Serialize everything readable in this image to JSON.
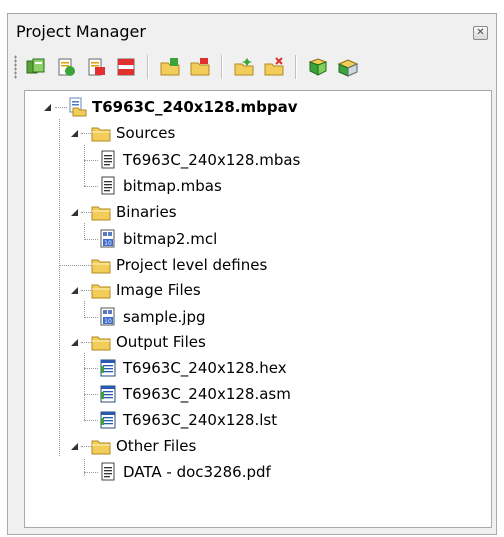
{
  "panel": {
    "title": "Project Manager"
  },
  "toolbar": {
    "buttons": [
      "open-project-icon",
      "add-file-icon",
      "remove-file-icon",
      "remove-all-icon",
      "new-folder-icon",
      "rename-folder-icon",
      "add-folder-icon",
      "remove-folder-icon",
      "build-icon",
      "build-all-icon"
    ]
  },
  "tree": {
    "project": "T6963C_240x128.mbpav",
    "sources": {
      "label": "Sources",
      "files": [
        "T6963C_240x128.mbas",
        "bitmap.mbas"
      ]
    },
    "binaries": {
      "label": "Binaries",
      "files": [
        "bitmap2.mcl"
      ]
    },
    "defines": {
      "label": "Project level defines"
    },
    "images": {
      "label": "Image Files",
      "files": [
        "sample.jpg"
      ]
    },
    "outputs": {
      "label": "Output Files",
      "files": [
        "T6963C_240x128.hex",
        "T6963C_240x128.asm",
        "T6963C_240x128.lst"
      ]
    },
    "others": {
      "label": "Other Files",
      "files": [
        "DATA - doc3286.pdf"
      ]
    }
  },
  "colors": {
    "folder": "#f2cd5a",
    "selection": "#000000"
  }
}
